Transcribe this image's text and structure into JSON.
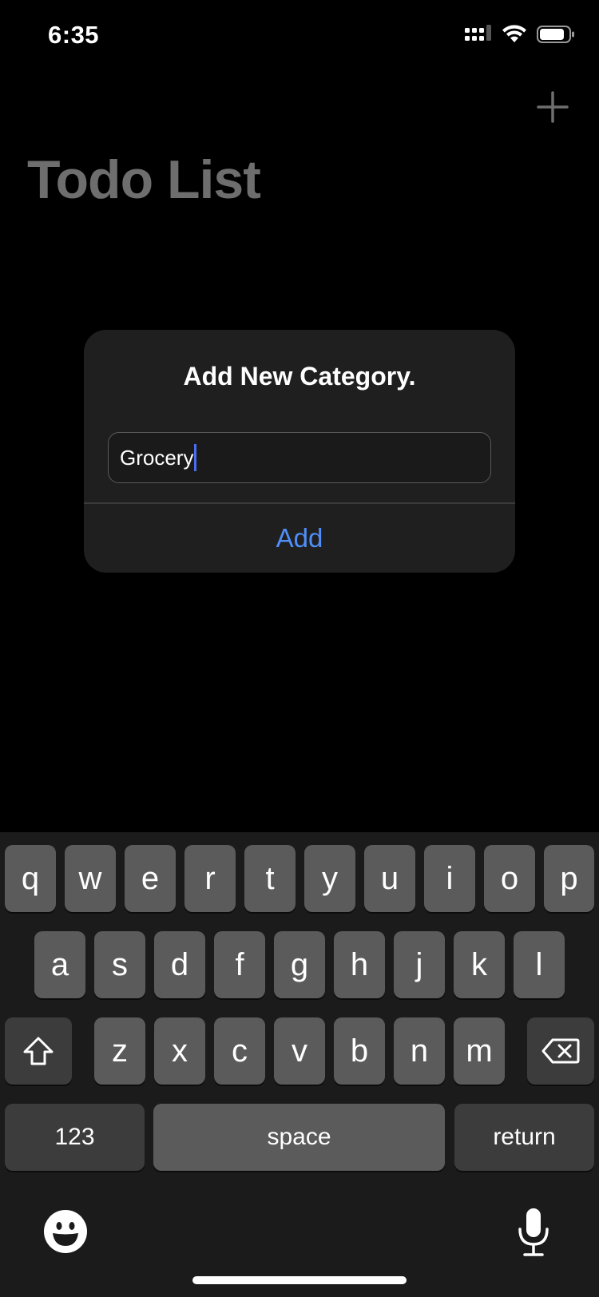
{
  "status_bar": {
    "time": "6:35",
    "icons": [
      "signal-icon",
      "wifi-icon",
      "battery-icon"
    ]
  },
  "nav": {
    "title": "Todo List",
    "add_icon": "plus-icon"
  },
  "alert": {
    "title": "Add New Category.",
    "input_value": "Grocery",
    "button_label": "Add"
  },
  "keyboard": {
    "row1": [
      "q",
      "w",
      "e",
      "r",
      "t",
      "y",
      "u",
      "i",
      "o",
      "p"
    ],
    "row2": [
      "a",
      "s",
      "d",
      "f",
      "g",
      "h",
      "j",
      "k",
      "l"
    ],
    "row3": [
      "z",
      "x",
      "c",
      "v",
      "b",
      "n",
      "m"
    ],
    "numbers_label": "123",
    "space_label": "space",
    "return_label": "return",
    "icons": [
      "shift-icon",
      "backspace-icon",
      "emoji-icon",
      "microphone-icon"
    ]
  },
  "colors": {
    "accent": "#4f8ef7",
    "caret": "#4a6cf0",
    "title_gray": "#6e6e6e",
    "alert_bg": "#1f1f1f",
    "key_light": "#5b5b5b",
    "key_dark": "#3c3c3c"
  }
}
